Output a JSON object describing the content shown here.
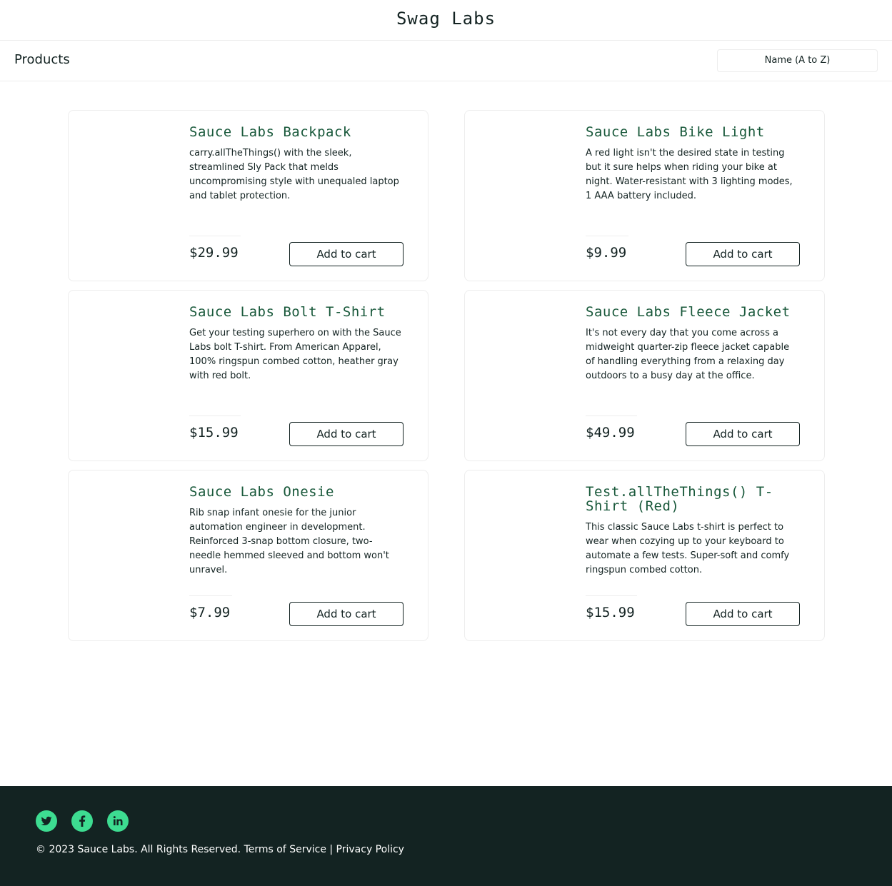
{
  "header": {
    "app_title": "Swag Labs"
  },
  "subheader": {
    "title": "Products",
    "sort_selected": "Name (A to Z)"
  },
  "products": [
    {
      "name": "Sauce Labs Backpack",
      "description": "carry.allTheThings() with the sleek, streamlined Sly Pack that melds uncompromising style with unequaled laptop and tablet protection.",
      "price": "$29.99",
      "button": "Add to cart"
    },
    {
      "name": "Sauce Labs Bike Light",
      "description": "A red light isn't the desired state in testing but it sure helps when riding your bike at night. Water-resistant with 3 lighting modes, 1 AAA battery included.",
      "price": "$9.99",
      "button": "Add to cart"
    },
    {
      "name": "Sauce Labs Bolt T-Shirt",
      "description": "Get your testing superhero on with the Sauce Labs bolt T-shirt. From American Apparel, 100% ringspun combed cotton, heather gray with red bolt.",
      "price": "$15.99",
      "button": "Add to cart"
    },
    {
      "name": "Sauce Labs Fleece Jacket",
      "description": "It's not every day that you come across a midweight quarter-zip fleece jacket capable of handling everything from a relaxing day outdoors to a busy day at the office.",
      "price": "$49.99",
      "button": "Add to cart"
    },
    {
      "name": "Sauce Labs Onesie",
      "description": "Rib snap infant onesie for the junior automation engineer in development. Reinforced 3-snap bottom closure, two-needle hemmed sleeved and bottom won't unravel.",
      "price": "$7.99",
      "button": "Add to cart"
    },
    {
      "name": "Test.allTheThings() T-Shirt (Red)",
      "description": "This classic Sauce Labs t-shirt is perfect to wear when cozying up to your keyboard to automate a few tests. Super-soft and comfy ringspun combed cotton.",
      "price": "$15.99",
      "button": "Add to cart"
    }
  ],
  "footer": {
    "social": [
      "twitter-icon",
      "facebook-icon",
      "linkedin-icon"
    ],
    "copyright": "© 2023 Sauce Labs. All Rights Reserved. Terms of Service | Privacy Policy"
  },
  "colors": {
    "accent": "#3ddc91",
    "product_name": "#18583a",
    "footer_bg": "#132322",
    "text": "#132322"
  }
}
